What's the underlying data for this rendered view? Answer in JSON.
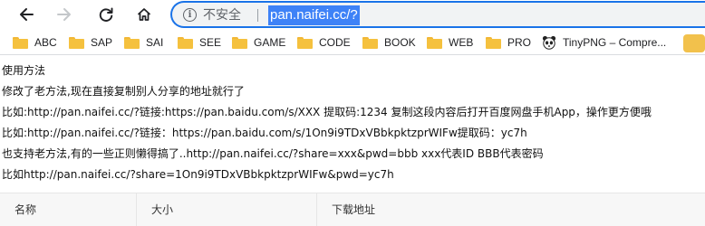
{
  "browser": {
    "security_label": "不安全",
    "url": "pan.naifei.cc/?"
  },
  "bookmarks": [
    {
      "label": "ABC",
      "icon": "folder-icon"
    },
    {
      "label": "SAP",
      "icon": "folder-icon"
    },
    {
      "label": "SAI",
      "icon": "folder-icon"
    },
    {
      "label": "SEE",
      "icon": "folder-icon"
    },
    {
      "label": "GAME",
      "icon": "folder-icon"
    },
    {
      "label": "CODE",
      "icon": "folder-icon"
    },
    {
      "label": "BOOK",
      "icon": "folder-icon"
    },
    {
      "label": "WEB",
      "icon": "folder-icon"
    },
    {
      "label": "PRO",
      "icon": "folder-icon"
    },
    {
      "label": "TinyPNG – Compre...",
      "icon": "panda-icon"
    }
  ],
  "content": {
    "lines": [
      "使用方法",
      "修改了老方法,现在直接复制别人分享的地址就行了",
      "比如:http://pan.naifei.cc/?链接:https://pan.baidu.com/s/XXX 提取码:1234 复制这段内容后打开百度网盘手机App，操作更方便哦",
      "比如:http://pan.naifei.cc/?链接：https://pan.baidu.com/s/1On9i9TDxVBbkpktzprWIFw提取码：yc7h",
      "也支持老方法,有的一些正则懒得搞了..http://pan.naifei.cc/?share=xxx&pwd=bbb xxx代表ID BBB代表密码",
      "比如http://pan.naifei.cc/?share=1On9i9TDxVBbkpktzprWIFw&pwd=yc7h"
    ]
  },
  "table": {
    "headers": [
      "名称",
      "大小",
      "下载地址"
    ]
  }
}
